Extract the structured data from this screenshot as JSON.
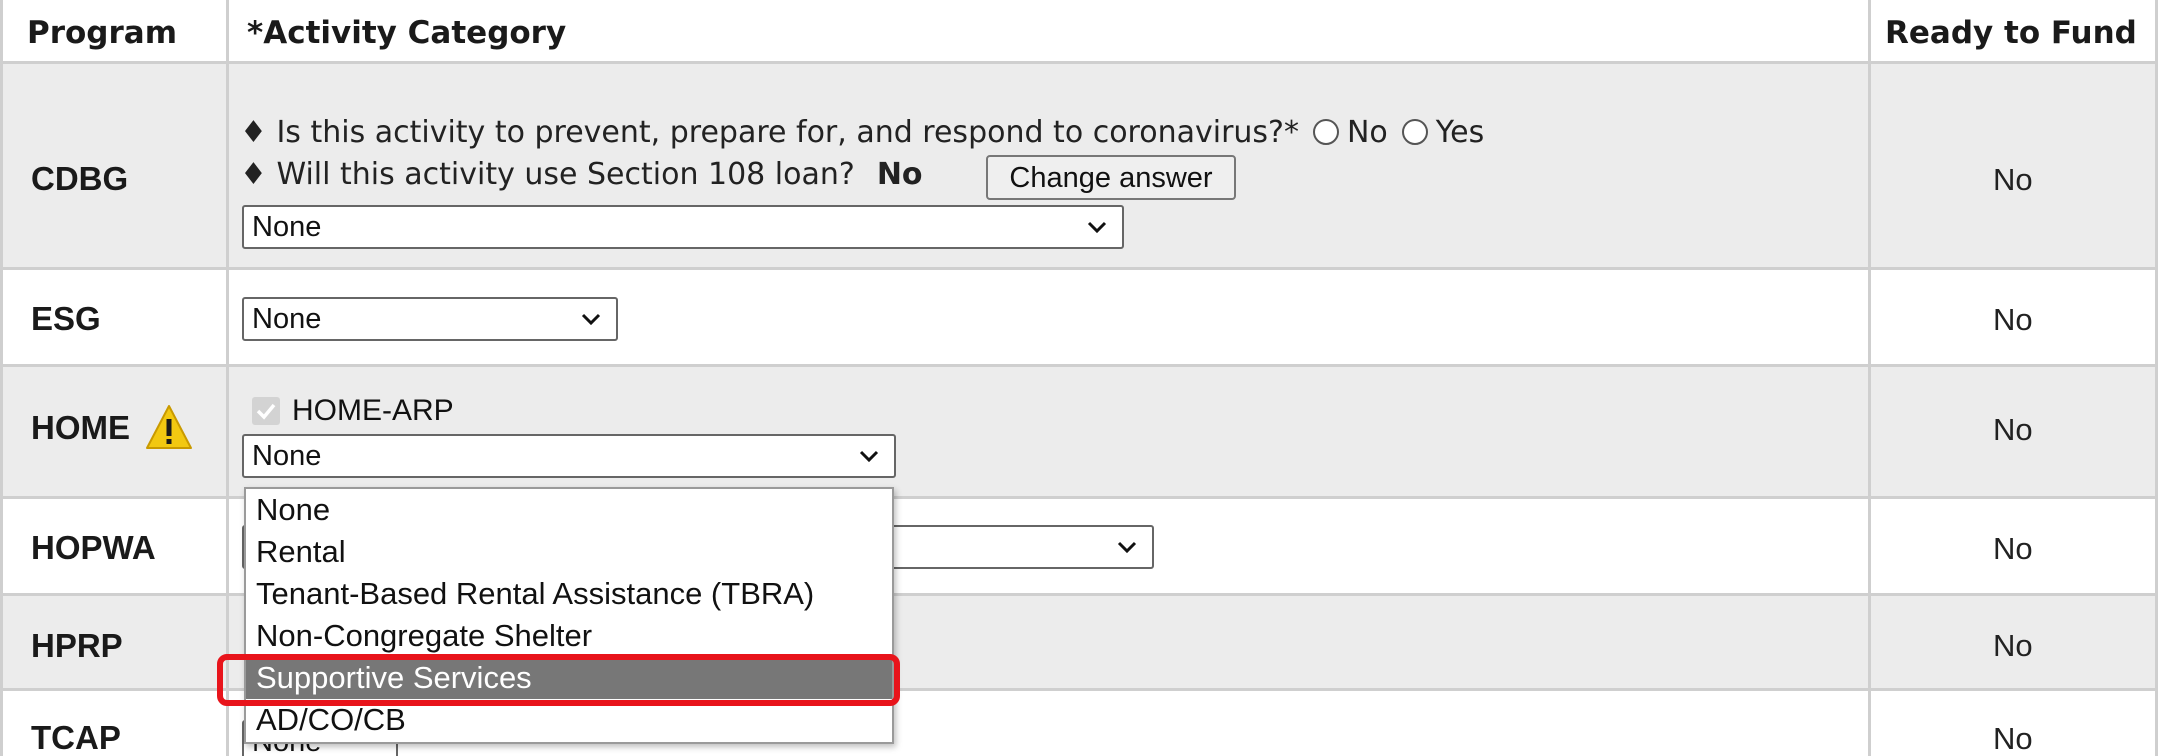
{
  "headers": {
    "program": "Program",
    "activity_category": "*Activity Category",
    "ready_to_fund": "Ready to Fund"
  },
  "rows": {
    "cdbg": {
      "program": "CDBG",
      "question1": "Is this activity to prevent, prepare for, and respond to coronavirus?*",
      "question1_options": [
        "No",
        "Yes"
      ],
      "question2": "Will this activity use Section 108 loan?",
      "question2_answer": "No",
      "change_button": "Change answer",
      "select_value": "None",
      "ready": "No"
    },
    "esg": {
      "program": "ESG",
      "select_value": "None",
      "ready": "No"
    },
    "home": {
      "program": "HOME",
      "checkbox_label": "HOME-ARP",
      "checkbox_checked": true,
      "select_value": "None",
      "ready": "No",
      "warning_icon": "warning-icon"
    },
    "hopwa": {
      "program": "HOPWA",
      "ready": "No"
    },
    "hprp": {
      "program": "HPRP",
      "ready": "No"
    },
    "tcap": {
      "program": "TCAP",
      "select_value": "None",
      "ready": "No"
    }
  },
  "dropdown": {
    "options": [
      "None",
      "Rental",
      "Tenant-Based Rental Assistance (TBRA)",
      "Non-Congregate Shelter",
      "Supportive Services",
      "AD/CO/CB"
    ],
    "highlighted": "Supportive Services"
  },
  "colors": {
    "highlight_border": "#e8141b",
    "selected_option_bg": "#777777",
    "row_gray": "#ececec",
    "grid": "#cfcfcf"
  }
}
